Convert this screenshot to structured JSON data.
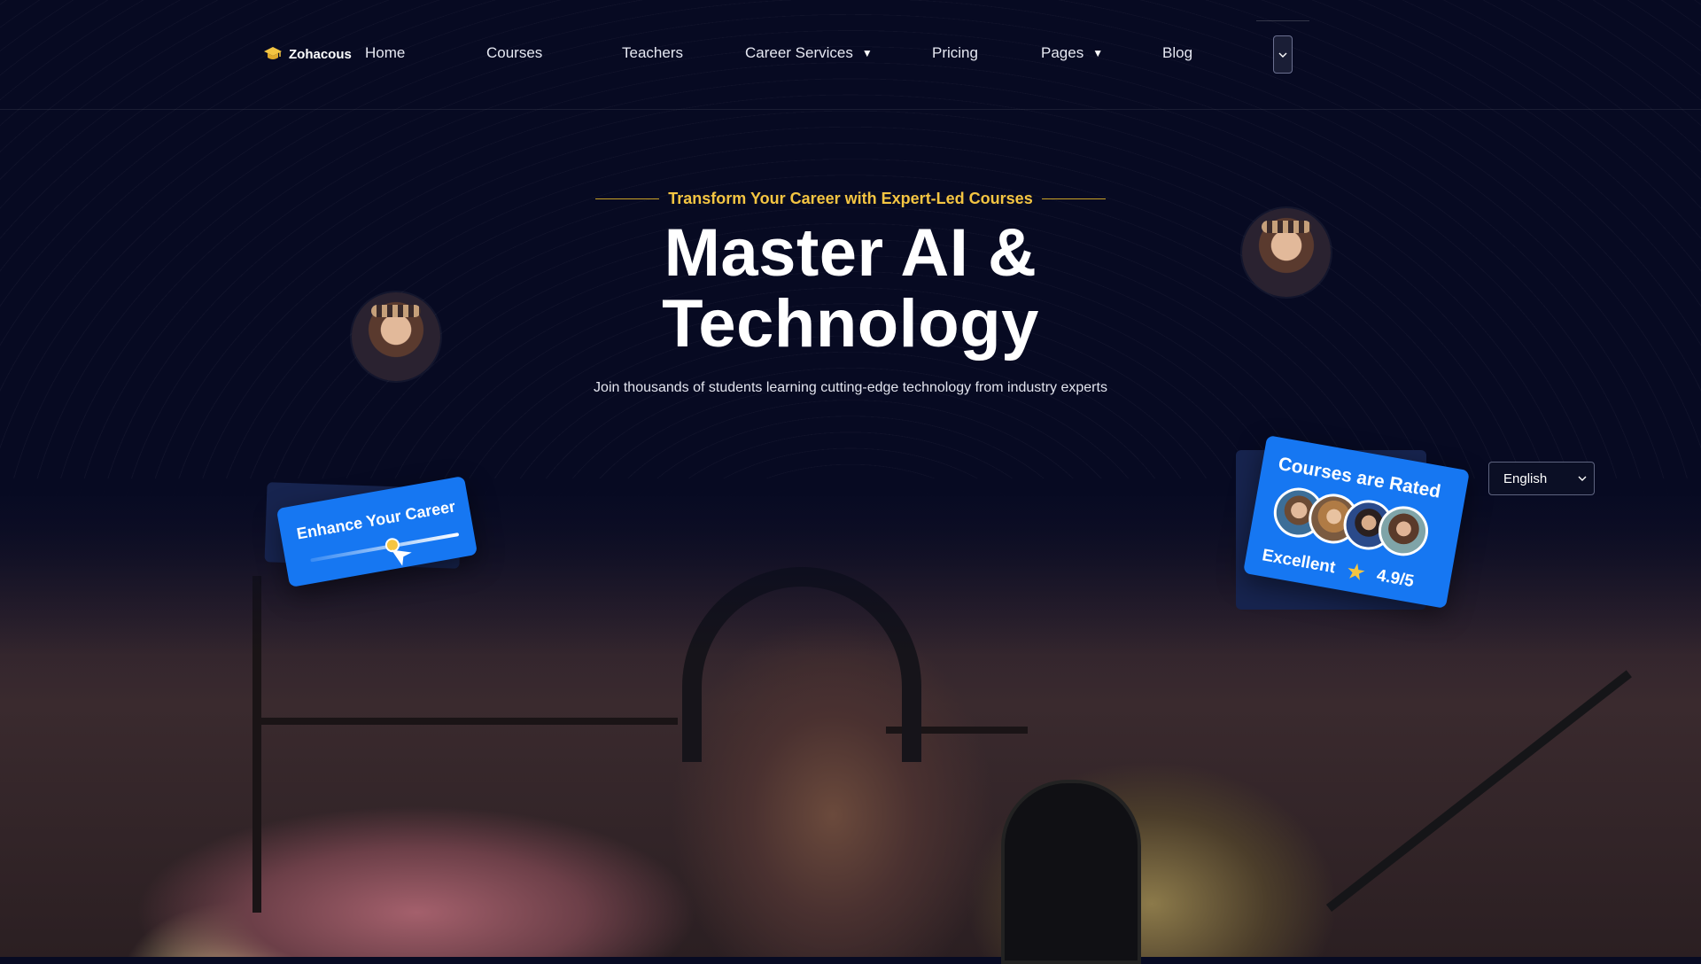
{
  "brand": {
    "name": "Zohacous",
    "logo_icon": "graduation-cap-icon"
  },
  "nav": {
    "items": [
      {
        "label": "Home",
        "has_caret": false
      },
      {
        "label": "Courses",
        "has_caret": false
      },
      {
        "label": "Teachers",
        "has_caret": false
      },
      {
        "label": "Career Services",
        "has_caret": true
      },
      {
        "label": "Pricing",
        "has_caret": false
      },
      {
        "label": "Pages",
        "has_caret": true
      },
      {
        "label": "Blog",
        "has_caret": false
      }
    ],
    "caret_glyph": "▼",
    "menu_button_icon": "chevron-down-icon"
  },
  "hero": {
    "kicker": "Transform Your Career with Expert-Led Courses",
    "title_line1": "Master AI &",
    "title_line2": "Technology",
    "subtitle": "Join thousands of students learning cutting-edge technology from industry experts"
  },
  "cards": {
    "enhance": {
      "label": "Enhance Your Career",
      "slider_fraction": 0.55
    },
    "rated": {
      "title": "Courses are Rated",
      "rating_label": "Excellent",
      "rating_value": "4.9/5",
      "avatar_count": 4
    }
  },
  "language": {
    "selected": "English"
  },
  "colors": {
    "accent": "#f4c542",
    "card_blue": "#1677f2",
    "background": "#070a22"
  }
}
